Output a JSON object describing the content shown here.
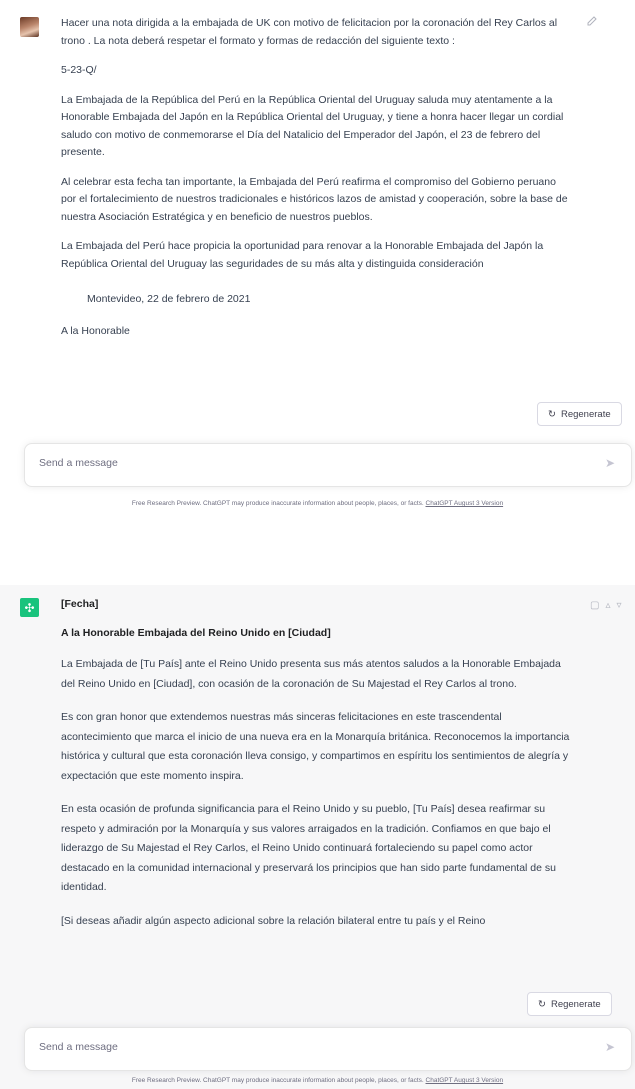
{
  "top": {
    "prompt": [
      "Hacer una nota dirigida a la embajada de UK con motivo de felicitacion por la coronación del Rey Carlos al trono . La nota deberá respetar el formato y formas de redacción del siguiente texto :",
      "5-23-Q/",
      "La Embajada de la República del Perú en la República Oriental del Uruguay saluda muy atentamente a la Honorable Embajada del Japón en la República Oriental del Uruguay, y tiene a honra hacer llegar un cordial saludo con motivo de conmemorarse el Día del Natalicio del Emperador del Japón, el 23 de febrero del presente.",
      "Al celebrar esta fecha tan importante, la Embajada del Perú reafirma el compromiso del Gobierno peruano por el fortalecimiento de nuestros tradicionales e históricos lazos de amistad y cooperación, sobre la base de nuestra Asociación Estratégica y en beneficio de nuestros pueblos.",
      " La Embajada del Perú hace propicia la oportunidad para renovar a la Honorable Embajada del Japón la República Oriental del Uruguay las seguridades de su más alta y distinguida consideración"
    ],
    "date_line": "Montevideo, 22 de febrero de 2021",
    "cut_line": "A la Honorable",
    "regenerate": "Regenerate",
    "input_placeholder": "Send a message",
    "footer_text": "Free Research Preview. ChatGPT may produce inaccurate information about people, places, or facts.",
    "footer_link": "ChatGPT August 3 Version"
  },
  "bottom": {
    "paragraphs": [
      "[Fecha]",
      "A la Honorable Embajada del Reino Unido en [Ciudad]",
      "La Embajada de [Tu País] ante el Reino Unido presenta sus más atentos saludos a la Honorable Embajada del Reino Unido en [Ciudad], con ocasión de la coronación de Su Majestad el Rey Carlos al trono.",
      "Es con gran honor que extendemos nuestras más sinceras felicitaciones en este trascendental acontecimiento que marca el inicio de una nueva era en la Monarquía británica. Reconocemos la importancia histórica y cultural que esta coronación lleva consigo, y compartimos en espíritu los sentimientos de alegría y expectación que este momento inspira.",
      "En esta ocasión de profunda significancia para el Reino Unido y su pueblo, [Tu País] desea reafirmar su respeto y admiración por la Monarquía y sus valores arraigados en la tradición. Confiamos en que bajo el liderazgo de Su Majestad el Rey Carlos, el Reino Unido continuará fortaleciendo su papel como actor destacado en la comunidad internacional y preservará los principios que han sido parte fundamental de su identidad.",
      "[Si deseas añadir algún aspecto adicional sobre la relación bilateral entre tu país y el Reino"
    ],
    "regenerate": "Regenerate",
    "input_placeholder": "Send a message",
    "footer_text": "Free Research Preview. ChatGPT may produce inaccurate information about people, places, or facts.",
    "footer_link": "ChatGPT August 3 Version"
  },
  "icons": {
    "edit": "edit-icon",
    "copy": "copy-icon",
    "thumbs_up": "thumbs-up-icon",
    "thumbs_down": "thumbs-down-icon",
    "regenerate": "refresh-icon",
    "send": "send-icon",
    "bot": "openai-logo-icon"
  }
}
